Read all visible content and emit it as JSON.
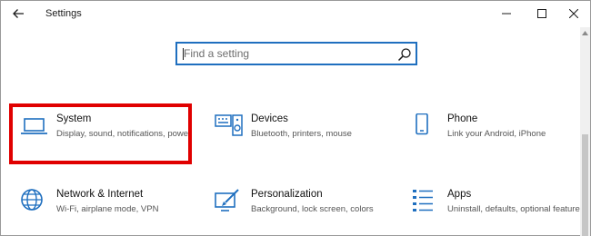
{
  "window": {
    "title": "Settings",
    "back_icon": "arrow-left-icon",
    "controls": [
      "minimize-icon",
      "maximize-icon",
      "close-icon"
    ]
  },
  "search": {
    "placeholder": "Find a setting",
    "icon": "search-icon",
    "accent": "#1f6fbf"
  },
  "tiles": [
    {
      "title": "System",
      "desc": "Display, sound, notifications, power",
      "icon": "laptop-icon"
    },
    {
      "title": "Devices",
      "desc": "Bluetooth, printers, mouse",
      "icon": "keyboard-speaker-icon"
    },
    {
      "title": "Phone",
      "desc": "Link your Android, iPhone",
      "icon": "phone-icon"
    },
    {
      "title": "Network & Internet",
      "desc": "Wi-Fi, airplane mode, VPN",
      "icon": "globe-icon"
    },
    {
      "title": "Personalization",
      "desc": "Background, lock screen, colors",
      "icon": "brush-monitor-icon"
    },
    {
      "title": "Apps",
      "desc": "Uninstall, defaults, optional features",
      "icon": "app-list-icon"
    }
  ],
  "colors": {
    "icon_blue": "#1f6fbf",
    "highlight_red": "#e00000"
  }
}
